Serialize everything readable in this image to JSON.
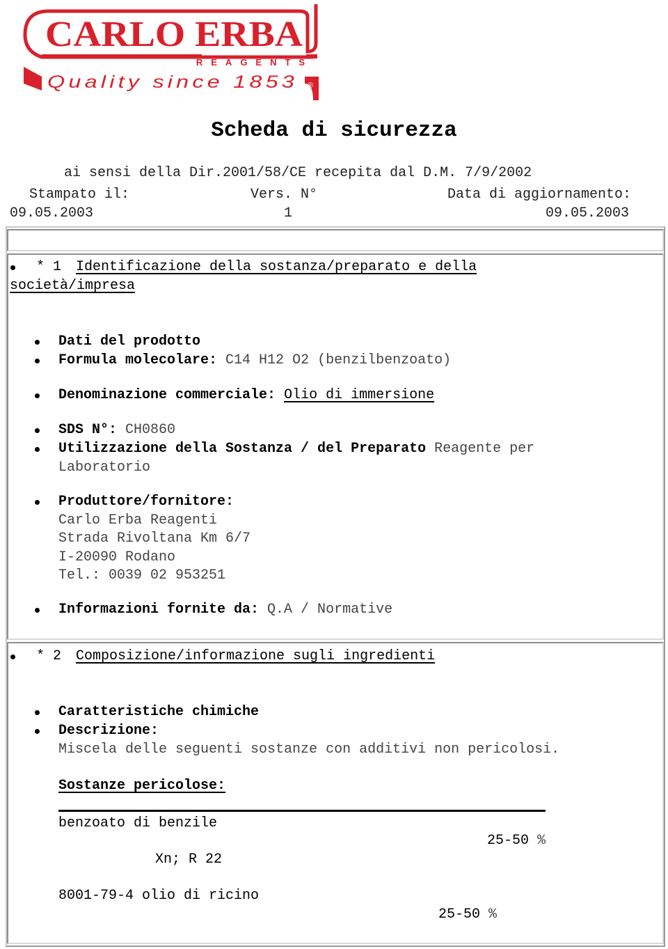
{
  "logo": {
    "brand": "CARLO ERBA",
    "sub": "REAGENTS",
    "tagline": "Quality since 1853",
    "mark": "®",
    "color": "#d9202b"
  },
  "header": {
    "title": "Scheda di sicurezza",
    "subtitle": "ai sensi della Dir.2001/58/CE recepita dal D.M. 7/9/2002",
    "printed_label": "Stampato il:",
    "version_label": "Vers. N°",
    "updated_label": "Data di aggiornamento:",
    "printed_value": "09.05.2003",
    "version_value": "1",
    "updated_value": "09.05.2003"
  },
  "section1": {
    "prefix": "* 1",
    "heading_line1": "Identificazione della sostanza/preparato e della",
    "heading_line2": "società/impresa",
    "product_data": "Dati del prodotto",
    "formula_label": "Formula molecolare:",
    "formula_value": " C14 H12 O2 (benzilbenzoato)",
    "trade_name_label": "Denominazione commerciale:",
    "trade_name_value": "Olio di immersione",
    "sds_label": "SDS N°:",
    "sds_value": " CH0860",
    "use_label": "Utilizzazione della Sostanza / del Preparato",
    "use_value_line1": " Reagente per",
    "use_value_line2": "Laboratorio",
    "producer_label": "Produttore/fornitore:",
    "producer_lines": [
      "Carlo Erba Reagenti",
      "Strada Rivoltana Km 6/7",
      "I-20090 Rodano",
      "Tel.: 0039 02 953251"
    ],
    "info_label": "Informazioni fornite da:",
    "info_value": " Q.A / Normative"
  },
  "section2": {
    "prefix": "* 2",
    "heading": "Composizione/informazione sugli ingredienti",
    "chem_char": "Caratteristiche chimiche",
    "desc_label": "Descrizione:",
    "desc_value": "Miscela delle seguenti sostanze con additivi non pericolosi.",
    "hazardous_label": "Sostanze pericolose:",
    "substances": [
      {
        "name": "benzoato di benzile",
        "range": "25-50",
        "unit": "%",
        "classification": "Xn; R 22"
      },
      {
        "name": "8001-79-4 olio di ricino",
        "range": "25-50",
        "unit": "%"
      }
    ]
  }
}
